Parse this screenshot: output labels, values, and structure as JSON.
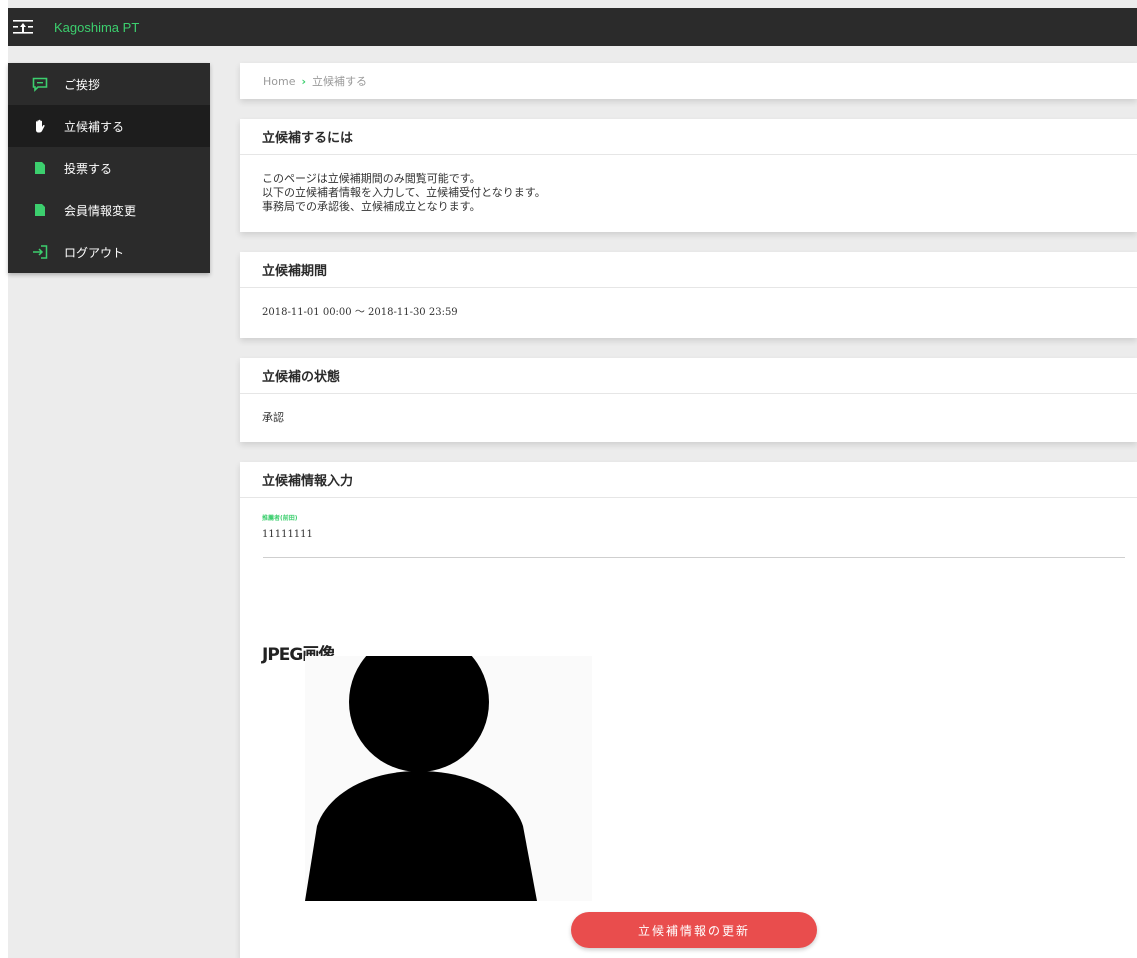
{
  "app": {
    "brand": "Kagoshima PT"
  },
  "sidebar": {
    "items": [
      {
        "label": "ご挨拶",
        "icon": "chat-icon"
      },
      {
        "label": "立候補する",
        "icon": "hand-icon"
      },
      {
        "label": "投票する",
        "icon": "document-icon"
      },
      {
        "label": "会員情報変更",
        "icon": "document-icon"
      },
      {
        "label": "ログアウト",
        "icon": "logout-icon"
      }
    ],
    "active_index": 1
  },
  "breadcrumb": {
    "home": "Home",
    "separator": "›",
    "current": "立候補する"
  },
  "intro": {
    "title": "立候補するには",
    "lines": [
      "このページは立候補期間のみ閲覧可能です。",
      "以下の立候補者情報を入力して、立候補受付となります。",
      "事務局での承認後、立候補成立となります。"
    ]
  },
  "period": {
    "title": "立候補期間",
    "value": "2018-11-01 00:00 〜 2018-11-30 23:59"
  },
  "status": {
    "title": "立候補の状態",
    "value": "承認"
  },
  "info": {
    "title": "立候補情報入力",
    "field_label": "推薦者(前田)",
    "field_value": "11111111",
    "image_title": "JPEG画像"
  },
  "button": {
    "update_label": "立候補情報の更新"
  },
  "colors": {
    "accent": "#3ccf6e",
    "button": "#e94d4d",
    "topbar": "#2b2b2b"
  }
}
